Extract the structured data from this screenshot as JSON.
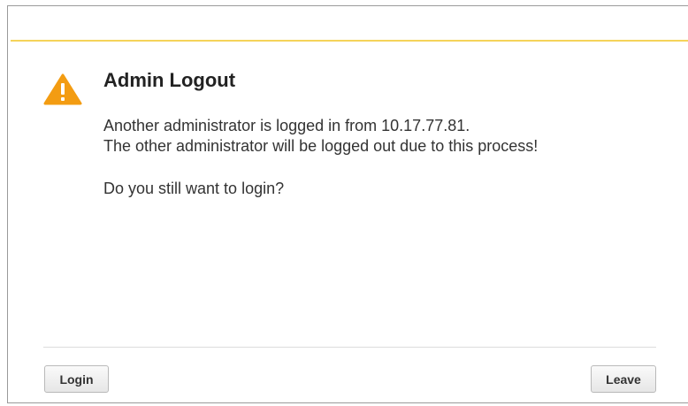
{
  "dialog": {
    "title": "Admin Logout",
    "message_line1": "Another administrator is logged in from 10.17.77.81.",
    "message_line2": "The other administrator will be logged out due to this process!",
    "question": "Do you still want to login?",
    "icon": "warning-triangle-icon",
    "accent_color": "#f5d35a",
    "icon_color": "#f39c12"
  },
  "buttons": {
    "login_label": "Login",
    "leave_label": "Leave"
  }
}
